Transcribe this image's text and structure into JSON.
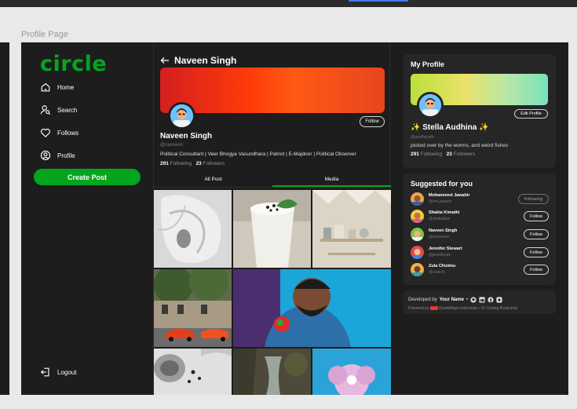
{
  "frame_label": "Profile Page",
  "brand": {
    "logo": "circle",
    "accent": "#04a51e"
  },
  "nav": {
    "items": [
      {
        "label": "Home",
        "icon": "home-icon"
      },
      {
        "label": "Search",
        "icon": "search-user-icon"
      },
      {
        "label": "Follows",
        "icon": "heart-icon"
      },
      {
        "label": "Profile",
        "icon": "profile-icon"
      }
    ],
    "create_post": "Create Post",
    "logout": "Logout"
  },
  "profile": {
    "header": "Naveen Singh",
    "follow": "Follow",
    "name": "Naveen Singh",
    "handle": "@naveeen",
    "bio": "Political Consultant | Veer Bhogya Vasundhara | Patriot | E-Majdoor | Political Observer",
    "following_count": "291",
    "following_label": "Following",
    "followers_count": "23",
    "followers_label": "Followers",
    "tabs": [
      "All Post",
      "Media"
    ],
    "active_tab": "Media",
    "media": [
      "marble-face-photo",
      "milkshake-photo",
      "kitchen-shelf-photo",
      "red-cars-street-photo",
      "colorful-portrait-photo",
      "silver-bowl-photo",
      "forest-waterfall-photo",
      "pink-flower-photo"
    ]
  },
  "my_profile": {
    "title": "My Profile",
    "edit": "Edit Profile",
    "name": "Stella Audhina",
    "sparkle": "✨",
    "handle": "@audhinafh",
    "bio": "picked over by the worms, and weird fishes",
    "following_count": "291",
    "following_label": "Following",
    "followers_count": "23",
    "followers_label": "Followers"
  },
  "suggested": {
    "title": "Suggested for you",
    "users": [
      {
        "name": "Mohammed Jawahir",
        "handle": "@em.jawahir",
        "button": "Following",
        "following": true
      },
      {
        "name": "Shakia Kimathi",
        "handle": "@shakiakim",
        "button": "Follow",
        "following": false
      },
      {
        "name": "Naveen Singh",
        "handle": "@naveeeen",
        "button": "Follow",
        "following": false
      },
      {
        "name": "Jennifer Stewart",
        "handle": "@jenniferste",
        "button": "Follow",
        "following": false
      },
      {
        "name": "Zula Chizimu",
        "handle": "@zulachi",
        "button": "Follow",
        "following": false
      }
    ]
  },
  "footer": {
    "developed_by": "Developed by",
    "your_name": "Your Name",
    "dot": "•",
    "powered": "Powered by",
    "company": "DumbWays Indonesia",
    "program": "• #1 Coding Bootcamp",
    "social_icons": [
      "github-icon",
      "linkedin-icon",
      "facebook-icon",
      "instagram-icon"
    ]
  }
}
